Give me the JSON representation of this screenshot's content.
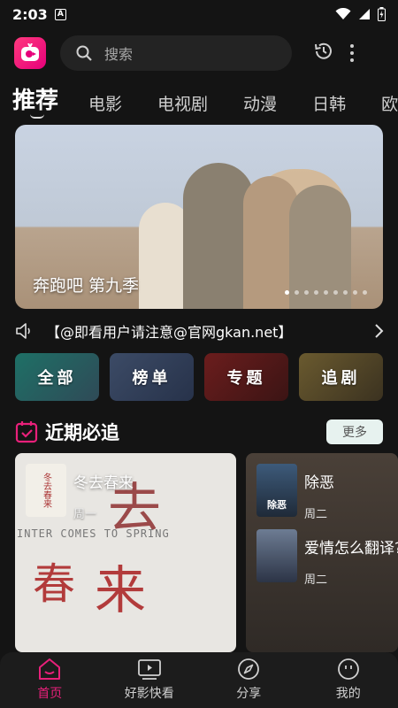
{
  "status_bar": {
    "time": "2:03",
    "notif_letter": "A"
  },
  "search": {
    "placeholder": "搜索"
  },
  "tabs": [
    {
      "label": "推荐",
      "active": true
    },
    {
      "label": "电影"
    },
    {
      "label": "电视剧"
    },
    {
      "label": "动漫"
    },
    {
      "label": "日韩"
    },
    {
      "label": "欧"
    }
  ],
  "banner": {
    "title": "奔跑吧 第九季",
    "dot_count": 9,
    "active_dot": 1
  },
  "notice": {
    "text": "【@即看用户请注意@官网gkan.net】"
  },
  "quick_links": [
    {
      "label": "全部"
    },
    {
      "label": "榜单"
    },
    {
      "label": "专题"
    },
    {
      "label": "追剧"
    }
  ],
  "section": {
    "title": "近期必追",
    "more_label": "更多"
  },
  "schedule": {
    "left": {
      "name": "冬去春来",
      "day": "周一",
      "deco_big_1": "春",
      "deco_big_2": "来",
      "deco_top": "去",
      "english": "INTER COMES TO SPRING",
      "thumb_text": "冬去春来"
    },
    "right": [
      {
        "name": "除恶",
        "day": "周二",
        "thumb_text": "除恶"
      },
      {
        "name": "爱情怎么翻译?",
        "day": "周二"
      }
    ]
  },
  "bottom_nav": [
    {
      "label": "首页",
      "icon": "home-icon",
      "active": true
    },
    {
      "label": "好影快看",
      "icon": "video-icon"
    },
    {
      "label": "分享",
      "icon": "compass-icon"
    },
    {
      "label": "我的",
      "icon": "profile-icon"
    }
  ],
  "colors": {
    "accent": "#e8207a",
    "background": "#141414"
  }
}
